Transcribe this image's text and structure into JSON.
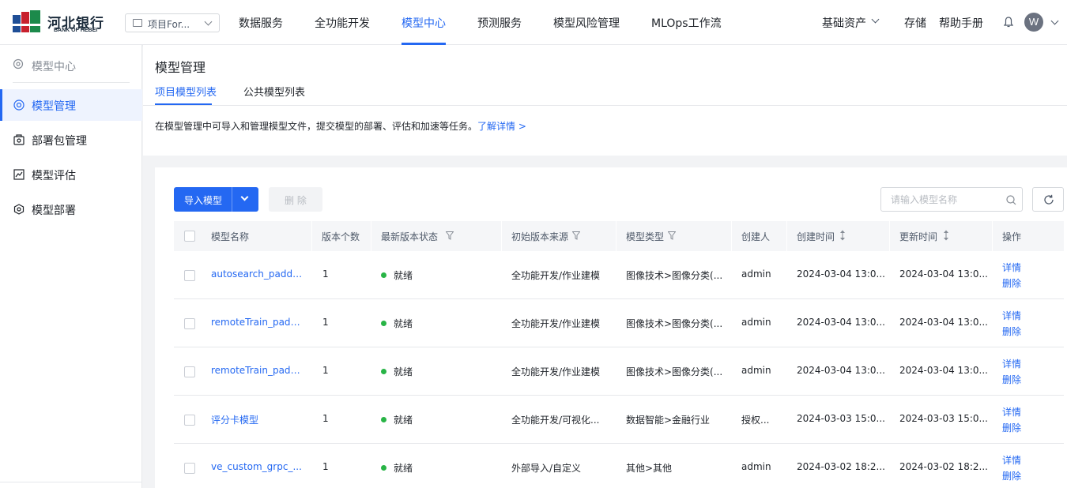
{
  "brand": {
    "name_cn": "河北银行",
    "name_en": "BANK OF HEBEI"
  },
  "colors": {
    "accent": "#2468f2",
    "status_ready": "#28b446"
  },
  "project_select": {
    "value": "项目For..."
  },
  "nav": {
    "items": [
      {
        "label": "数据服务"
      },
      {
        "label": "全功能开发"
      },
      {
        "label": "模型中心",
        "active": true
      },
      {
        "label": "预测服务"
      },
      {
        "label": "模型风险管理"
      },
      {
        "label": "MLOps工作流"
      }
    ],
    "assets": "基础资产",
    "storage": "存储",
    "help": "帮助手册",
    "avatar": "W"
  },
  "sidebar": {
    "header": "模型中心",
    "items": [
      {
        "label": "模型管理",
        "icon": "model-icon",
        "active": true
      },
      {
        "label": "部署包管理",
        "icon": "package-icon"
      },
      {
        "label": "模型评估",
        "icon": "chart-icon"
      },
      {
        "label": "模型部署",
        "icon": "deploy-icon"
      }
    ]
  },
  "page": {
    "title": "模型管理",
    "tabs": [
      {
        "label": "项目模型列表",
        "active": true
      },
      {
        "label": "公共模型列表"
      }
    ],
    "description": "在模型管理中可导入和管理模型文件，提交模型的部署、评估和加速等任务。",
    "description_link": "了解详情 >"
  },
  "toolbar": {
    "import_label": "导入模型",
    "delete_label": "删 除",
    "search_placeholder": "请输入模型名称"
  },
  "table": {
    "columns": [
      "模型名称",
      "版本个数",
      "最新版本状态",
      "初始版本来源",
      "模型类型",
      "创建人",
      "创建时间",
      "更新时间",
      "操作"
    ],
    "rows": [
      {
        "name": "autosearch_paddle...",
        "versions": "1",
        "status": "就绪",
        "source": "全功能开发/作业建模",
        "type": "图像技术>图像分类(...",
        "creator": "admin",
        "created": "2024-03-04 13:0...",
        "updated": "2024-03-04 13:0...",
        "op1": "详情",
        "op2": "删除"
      },
      {
        "name": "remoteTrain_paddl...",
        "versions": "1",
        "status": "就绪",
        "source": "全功能开发/作业建模",
        "type": "图像技术>图像分类(...",
        "creator": "admin",
        "created": "2024-03-04 13:0...",
        "updated": "2024-03-04 13:0...",
        "op1": "详情",
        "op2": "删除"
      },
      {
        "name": "remoteTrain_paddl...",
        "versions": "1",
        "status": "就绪",
        "source": "全功能开发/作业建模",
        "type": "图像技术>图像分类(...",
        "creator": "admin",
        "created": "2024-03-04 13:0...",
        "updated": "2024-03-04 13:0...",
        "op1": "详情",
        "op2": "删除"
      },
      {
        "name": "评分卡模型",
        "versions": "1",
        "status": "就绪",
        "source": "全功能开发/可视化...",
        "type": "数据智能>金融行业",
        "creator": "授权...",
        "created": "2024-03-03 15:0...",
        "updated": "2024-03-03 15:0...",
        "op1": "详情",
        "op2": "删除"
      },
      {
        "name": "ve_custom_grpc_...",
        "versions": "1",
        "status": "就绪",
        "source": "外部导入/自定义",
        "type": "其他>其他",
        "creator": "admin",
        "created": "2024-03-02 18:2...",
        "updated": "2024-03-02 18:2...",
        "op1": "详情",
        "op2": "删除"
      }
    ]
  }
}
